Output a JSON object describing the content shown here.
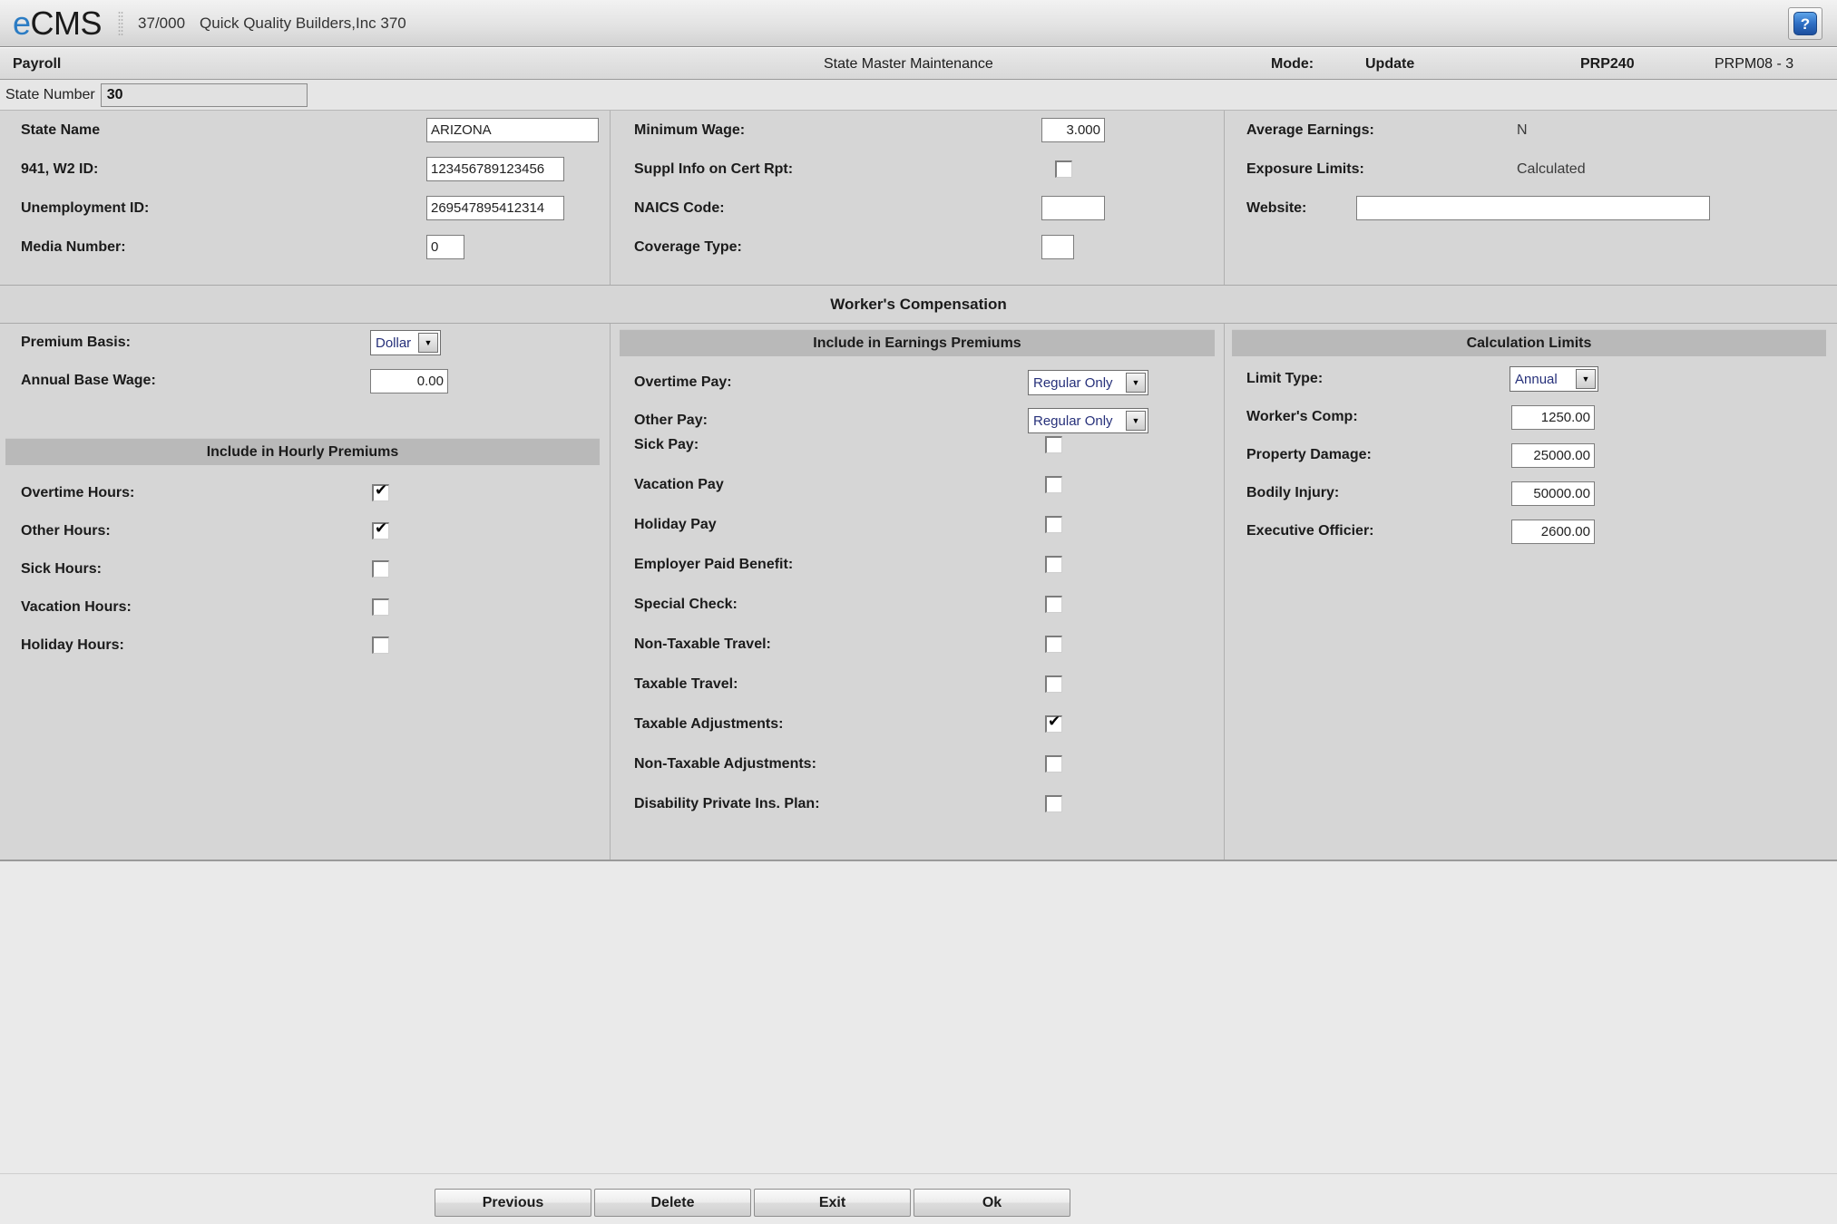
{
  "brand": {
    "logo_e": "e",
    "logo_rest": "CMS",
    "company_code": "37/000",
    "company_name": "Quick Quality Builders,Inc 370",
    "help_icon": "question-mark-icon",
    "help_label": "?"
  },
  "titlebar": {
    "module": "Payroll",
    "screen_title": "State Master Maintenance",
    "mode_label": "Mode:",
    "mode_value": "Update",
    "program": "PRP240",
    "program_id": "PRPM08 - 3"
  },
  "key": {
    "label": "State Number",
    "value": "30"
  },
  "state_info": {
    "state_name_label": "State Name",
    "state_name_value": "ARIZONA",
    "w2_id_label": "941, W2 ID:",
    "w2_id_value": "123456789123456",
    "unemployment_id_label": "Unemployment ID:",
    "unemployment_id_value": "269547895412314",
    "media_number_label": "Media Number:",
    "media_number_value": "0"
  },
  "wage_info": {
    "minimum_wage_label": "Minimum Wage:",
    "minimum_wage_value": "3.000",
    "suppl_info_label": "Suppl Info on Cert Rpt:",
    "suppl_info_checked": false,
    "naics_label": "NAICS Code:",
    "naics_value": "",
    "coverage_type_label": "Coverage Type:",
    "coverage_type_value": ""
  },
  "misc_info": {
    "average_earnings_label": "Average Earnings:",
    "average_earnings_value": "N",
    "exposure_limits_label": "Exposure Limits:",
    "exposure_limits_value": "Calculated",
    "website_label": "Website:",
    "website_value": ""
  },
  "workers_comp": {
    "banner": "Worker's Compensation",
    "premium_basis_label": "Premium Basis:",
    "premium_basis_value": "Dollar",
    "annual_base_wage_label": "Annual Base Wage:",
    "annual_base_wage_value": "0.00",
    "hourly_premiums_banner": "Include in Hourly Premiums",
    "hourly_items": [
      {
        "label": "Overtime Hours:",
        "checked": true
      },
      {
        "label": "Other Hours:",
        "checked": true
      },
      {
        "label": "Sick Hours:",
        "checked": false
      },
      {
        "label": "Vacation Hours:",
        "checked": false
      },
      {
        "label": "Holiday Hours:",
        "checked": false
      }
    ],
    "earnings_premiums_banner": "Include in Earnings Premiums",
    "earnings_dropdowns": [
      {
        "label": "Overtime Pay:",
        "value": "Regular Only"
      },
      {
        "label": "Other Pay:",
        "value": "Regular Only"
      }
    ],
    "earnings_items": [
      {
        "label": "Sick Pay:",
        "checked": false
      },
      {
        "label": "Vacation Pay",
        "checked": false
      },
      {
        "label": "Holiday Pay",
        "checked": false
      },
      {
        "label": "Employer Paid Benefit:",
        "checked": false
      },
      {
        "label": "Special Check:",
        "checked": false
      },
      {
        "label": "Non-Taxable Travel:",
        "checked": false
      },
      {
        "label": "Taxable Travel:",
        "checked": false
      },
      {
        "label": "Taxable Adjustments:",
        "checked": true
      },
      {
        "label": "Non-Taxable Adjustments:",
        "checked": false
      },
      {
        "label": "Disability Private Ins. Plan:",
        "checked": false
      }
    ],
    "calculation_limits_banner": "Calculation Limits",
    "limit_type_label": "Limit Type:",
    "limit_type_value": "Annual",
    "limit_fields": [
      {
        "label": "Worker's Comp:",
        "value": "1250.00"
      },
      {
        "label": "Property Damage:",
        "value": "25000.00"
      },
      {
        "label": "Bodily Injury:",
        "value": "50000.00"
      },
      {
        "label": "Executive Officier:",
        "value": "2600.00"
      }
    ]
  },
  "footer": {
    "buttons": [
      {
        "label": "Previous"
      },
      {
        "label": "Delete"
      },
      {
        "label": "Exit"
      },
      {
        "label": "Ok"
      }
    ]
  },
  "colors": {
    "brand_accent": "#2b7cc4",
    "panel_bg": "#d6d6d6",
    "banner_bg": "#b9b9b9",
    "page_bg": "#eaeaea"
  }
}
